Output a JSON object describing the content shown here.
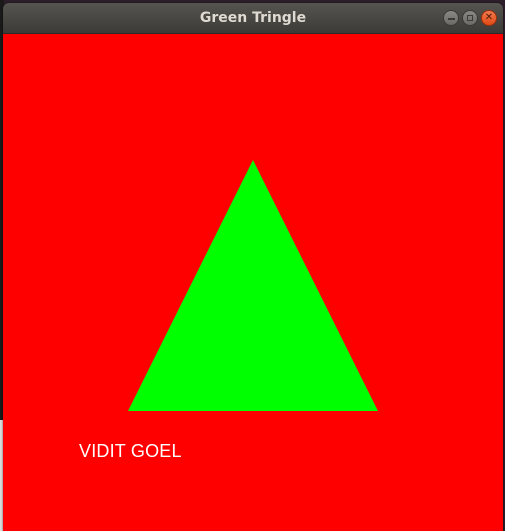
{
  "window": {
    "title": "Green Tringle",
    "minimize_icon": "minimize-icon",
    "maximize_icon": "maximize-icon",
    "close_icon": "close-icon"
  },
  "canvas": {
    "background_color": "#ff0000",
    "shape": {
      "kind": "triangle",
      "fill_color": "#00ff00"
    },
    "caption": "VIDIT GOEL",
    "caption_color": "#ffffff"
  }
}
